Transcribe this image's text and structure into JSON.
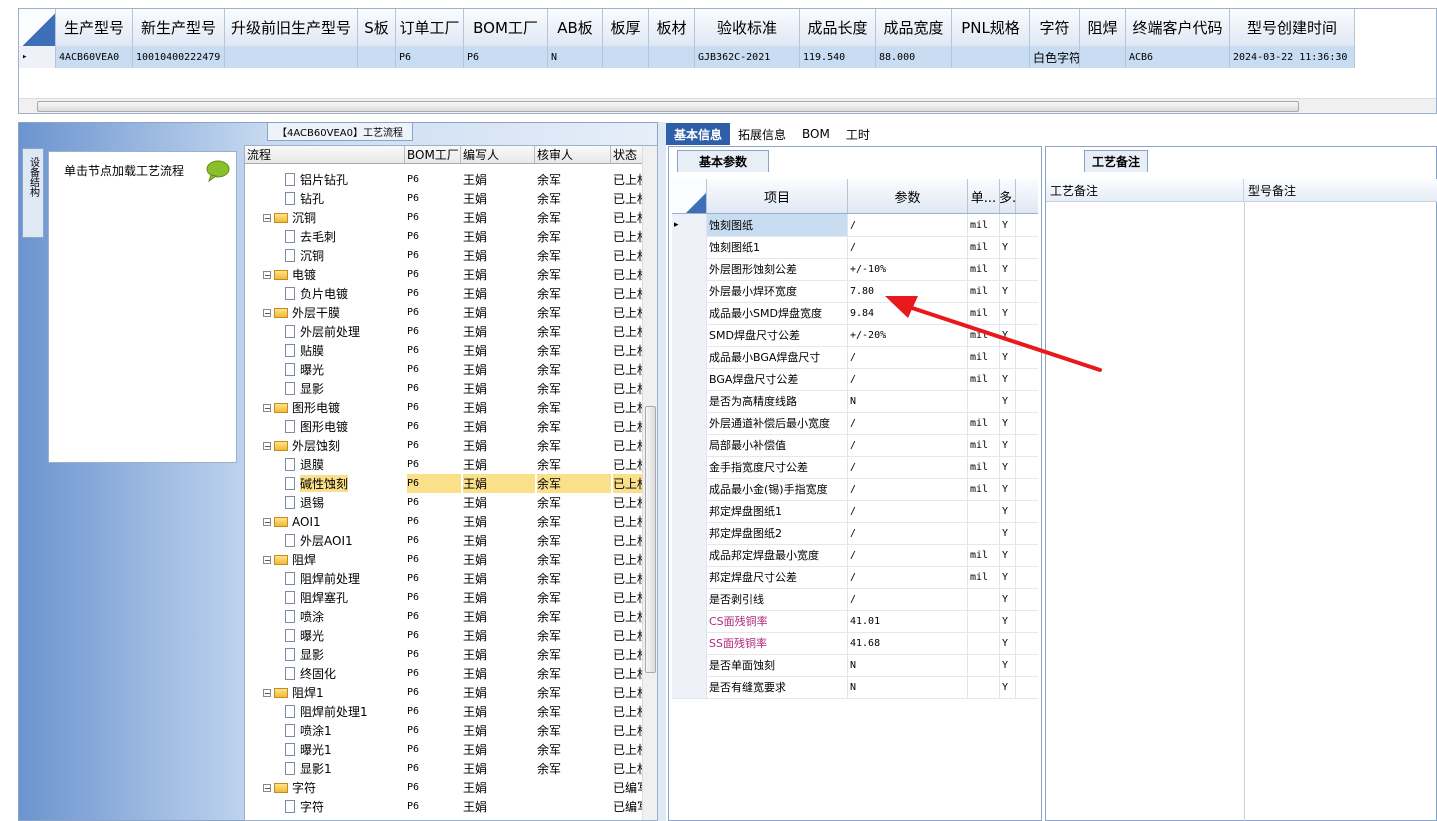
{
  "top_grid": {
    "columns": [
      "生产型号",
      "新生产型号",
      "升级前旧生产型号",
      "S板",
      "订单工厂",
      "BOM工厂",
      "AB板",
      "板厚",
      "板材",
      "验收标准",
      "成品长度",
      "成品宽度",
      "PNL规格",
      "字符",
      "阻焊",
      "终端客户代码",
      "型号创建时间"
    ],
    "row": [
      "4ACB60VEA0",
      "10010400222479",
      "",
      "",
      "P6",
      "P6",
      "N",
      "",
      "",
      "GJB362C-2021",
      "119.540",
      "88.000",
      "",
      "白色字符",
      "",
      "ACB6",
      "2024-03-22 11:36:30"
    ]
  },
  "flow_panel": {
    "title": "【4ACB60VEA0】工艺流程",
    "side_tab": "设备结构",
    "node_hint": "单击节点加载工艺流程",
    "tree_columns": [
      "流程",
      "BOM工厂",
      "编写人",
      "核审人",
      "状态"
    ],
    "tree_rows": [
      {
        "name": "铝片钻孔",
        "level": 2,
        "bom": "P6",
        "writer": "王娟",
        "reviewer": "余军",
        "status": "已上权"
      },
      {
        "name": "钻孔",
        "level": 2,
        "bom": "P6",
        "writer": "王娟",
        "reviewer": "余军",
        "status": "已上权"
      },
      {
        "name": "沉铜",
        "level": 1,
        "bom": "P6",
        "writer": "王娟",
        "reviewer": "余军",
        "status": "已上权"
      },
      {
        "name": "去毛刺",
        "level": 2,
        "bom": "P6",
        "writer": "王娟",
        "reviewer": "余军",
        "status": "已上权"
      },
      {
        "name": "沉铜",
        "level": 2,
        "bom": "P6",
        "writer": "王娟",
        "reviewer": "余军",
        "status": "已上权"
      },
      {
        "name": "电镀",
        "level": 1,
        "bom": "P6",
        "writer": "王娟",
        "reviewer": "余军",
        "status": "已上权"
      },
      {
        "name": "负片电镀",
        "level": 2,
        "bom": "P6",
        "writer": "王娟",
        "reviewer": "余军",
        "status": "已上权"
      },
      {
        "name": "外层干膜",
        "level": 1,
        "bom": "P6",
        "writer": "王娟",
        "reviewer": "余军",
        "status": "已上权"
      },
      {
        "name": "外层前处理",
        "level": 2,
        "bom": "P6",
        "writer": "王娟",
        "reviewer": "余军",
        "status": "已上权"
      },
      {
        "name": "贴膜",
        "level": 2,
        "bom": "P6",
        "writer": "王娟",
        "reviewer": "余军",
        "status": "已上权"
      },
      {
        "name": "曝光",
        "level": 2,
        "bom": "P6",
        "writer": "王娟",
        "reviewer": "余军",
        "status": "已上权"
      },
      {
        "name": "显影",
        "level": 2,
        "bom": "P6",
        "writer": "王娟",
        "reviewer": "余军",
        "status": "已上权"
      },
      {
        "name": "图形电镀",
        "level": 1,
        "bom": "P6",
        "writer": "王娟",
        "reviewer": "余军",
        "status": "已上权"
      },
      {
        "name": "图形电镀",
        "level": 2,
        "bom": "P6",
        "writer": "王娟",
        "reviewer": "余军",
        "status": "已上权"
      },
      {
        "name": "外层蚀刻",
        "level": 1,
        "bom": "P6",
        "writer": "王娟",
        "reviewer": "余军",
        "status": "已上权"
      },
      {
        "name": "退膜",
        "level": 2,
        "bom": "P6",
        "writer": "王娟",
        "reviewer": "余军",
        "status": "已上权"
      },
      {
        "name": "碱性蚀刻",
        "level": 2,
        "bom": "P6",
        "writer": "王娟",
        "reviewer": "余军",
        "status": "已上权",
        "selected": true
      },
      {
        "name": "退锡",
        "level": 2,
        "bom": "P6",
        "writer": "王娟",
        "reviewer": "余军",
        "status": "已上权"
      },
      {
        "name": "AOI1",
        "level": 1,
        "bom": "P6",
        "writer": "王娟",
        "reviewer": "余军",
        "status": "已上权"
      },
      {
        "name": "外层AOI1",
        "level": 2,
        "bom": "P6",
        "writer": "王娟",
        "reviewer": "余军",
        "status": "已上权"
      },
      {
        "name": "阻焊",
        "level": 1,
        "bom": "P6",
        "writer": "王娟",
        "reviewer": "余军",
        "status": "已上权"
      },
      {
        "name": "阻焊前处理",
        "level": 2,
        "bom": "P6",
        "writer": "王娟",
        "reviewer": "余军",
        "status": "已上权"
      },
      {
        "name": "阻焊塞孔",
        "level": 2,
        "bom": "P6",
        "writer": "王娟",
        "reviewer": "余军",
        "status": "已上权"
      },
      {
        "name": "喷涂",
        "level": 2,
        "bom": "P6",
        "writer": "王娟",
        "reviewer": "余军",
        "status": "已上权"
      },
      {
        "name": "曝光",
        "level": 2,
        "bom": "P6",
        "writer": "王娟",
        "reviewer": "余军",
        "status": "已上权"
      },
      {
        "name": "显影",
        "level": 2,
        "bom": "P6",
        "writer": "王娟",
        "reviewer": "余军",
        "status": "已上权"
      },
      {
        "name": "终固化",
        "level": 2,
        "bom": "P6",
        "writer": "王娟",
        "reviewer": "余军",
        "status": "已上权"
      },
      {
        "name": "阻焊1",
        "level": 1,
        "bom": "P6",
        "writer": "王娟",
        "reviewer": "余军",
        "status": "已上权"
      },
      {
        "name": "阻焊前处理1",
        "level": 2,
        "bom": "P6",
        "writer": "王娟",
        "reviewer": "余军",
        "status": "已上权"
      },
      {
        "name": "喷涂1",
        "level": 2,
        "bom": "P6",
        "writer": "王娟",
        "reviewer": "余军",
        "status": "已上权"
      },
      {
        "name": "曝光1",
        "level": 2,
        "bom": "P6",
        "writer": "王娟",
        "reviewer": "余军",
        "status": "已上权"
      },
      {
        "name": "显影1",
        "level": 2,
        "bom": "P6",
        "writer": "王娟",
        "reviewer": "余军",
        "status": "已上权"
      },
      {
        "name": "字符",
        "level": 1,
        "bom": "P6",
        "writer": "王娟",
        "reviewer": "",
        "status": "已编写"
      },
      {
        "name": "字符",
        "level": 2,
        "bom": "P6",
        "writer": "王娟",
        "reviewer": "",
        "status": "已编写"
      }
    ]
  },
  "tabs": [
    "基本信息",
    "拓展信息",
    "BOM",
    "工时"
  ],
  "params_panel": {
    "sub_tab": "基本参数",
    "columns": [
      "项目",
      "参数",
      "单...",
      "多."
    ],
    "rows": [
      {
        "item": "蚀刻图纸",
        "value": "/",
        "unit": "mil",
        "flag": "Y"
      },
      {
        "item": "蚀刻图纸1",
        "value": "/",
        "unit": "mil",
        "flag": "Y"
      },
      {
        "item": "外层图形蚀刻公差",
        "value": "+/-10%",
        "unit": "mil",
        "flag": "Y"
      },
      {
        "item": "外层最小焊环宽度",
        "value": "7.80",
        "unit": "mil",
        "flag": "Y"
      },
      {
        "item": "成品最小SMD焊盘宽度",
        "value": "9.84",
        "unit": "mil",
        "flag": "Y"
      },
      {
        "item": "SMD焊盘尺寸公差",
        "value": "+/-20%",
        "unit": "mil",
        "flag": "Y"
      },
      {
        "item": "成品最小BGA焊盘尺寸",
        "value": "/",
        "unit": "mil",
        "flag": "Y"
      },
      {
        "item": "BGA焊盘尺寸公差",
        "value": "/",
        "unit": "mil",
        "flag": "Y"
      },
      {
        "item": "是否为高精度线路",
        "value": "N",
        "unit": "",
        "flag": "Y"
      },
      {
        "item": "外层通道补偿后最小宽度",
        "value": "/",
        "unit": "mil",
        "flag": "Y"
      },
      {
        "item": "局部最小补偿值",
        "value": "/",
        "unit": "mil",
        "flag": "Y"
      },
      {
        "item": "金手指宽度尺寸公差",
        "value": "/",
        "unit": "mil",
        "flag": "Y"
      },
      {
        "item": "成品最小金(锡)手指宽度",
        "value": "/",
        "unit": "mil",
        "flag": "Y"
      },
      {
        "item": "邦定焊盘图纸1",
        "value": "/",
        "unit": "",
        "flag": "Y"
      },
      {
        "item": "邦定焊盘图纸2",
        "value": "/",
        "unit": "",
        "flag": "Y"
      },
      {
        "item": "成品邦定焊盘最小宽度",
        "value": "/",
        "unit": "mil",
        "flag": "Y"
      },
      {
        "item": "邦定焊盘尺寸公差",
        "value": "/",
        "unit": "mil",
        "flag": "Y"
      },
      {
        "item": "是否剥引线",
        "value": "/",
        "unit": "",
        "flag": "Y"
      },
      {
        "item": "CS面残铜率",
        "value": "41.01",
        "unit": "",
        "flag": "Y",
        "pink": true
      },
      {
        "item": "SS面残铜率",
        "value": "41.68",
        "unit": "",
        "flag": "Y",
        "pink": true
      },
      {
        "item": "是否单面蚀刻",
        "value": "N",
        "unit": "",
        "flag": "Y"
      },
      {
        "item": "是否有缝宽要求",
        "value": "N",
        "unit": "",
        "flag": "Y"
      }
    ]
  },
  "notes_panel": {
    "sub_tab": "工艺备注",
    "columns": [
      "工艺备注",
      "型号备注"
    ]
  },
  "colors": {
    "accent": "#2e5fa8",
    "selection": "#fbe08a",
    "arrow": "#e8191a"
  }
}
